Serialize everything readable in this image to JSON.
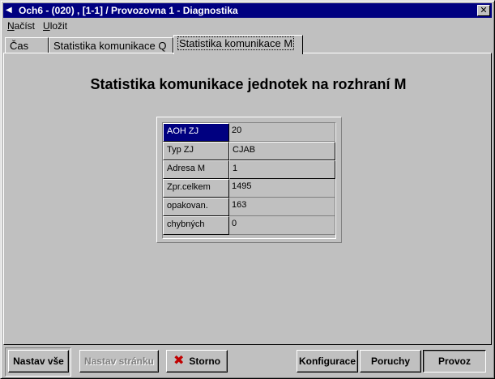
{
  "window": {
    "title": "Och6 - (020) , [1-1] / Provozovna 1 - Diagnostika",
    "close_glyph": "✕"
  },
  "menu": [
    {
      "label": "Načíst"
    },
    {
      "label": "Uložit"
    }
  ],
  "tabs": [
    {
      "label": "Čas",
      "active": false
    },
    {
      "label": "Statistika komunikace Q",
      "active": false
    },
    {
      "label": "Statistika komunikace M",
      "active": true
    }
  ],
  "panel": {
    "heading": "Statistika komunikace jednotek na rozhraní M",
    "rows": [
      {
        "label": "AOH ZJ",
        "value": "20"
      },
      {
        "label": "Typ ZJ",
        "value": "CJAB"
      },
      {
        "label": "Adresa M",
        "value": "1"
      },
      {
        "label": "Zpr.celkem",
        "value": "1495"
      },
      {
        "label": "opakovan.",
        "value": "163"
      },
      {
        "label": "chybných",
        "value": "0"
      }
    ]
  },
  "buttons": {
    "nastav_vse": "Nastav vše",
    "nastav_stranku": "Nastav stránku",
    "storno": "Storno",
    "konfigurace": "Konfigurace",
    "poruchy": "Poruchy",
    "provoz": "Provoz"
  },
  "icons": {
    "system": "left-arrow-icon",
    "storno": "red-x-icon"
  }
}
